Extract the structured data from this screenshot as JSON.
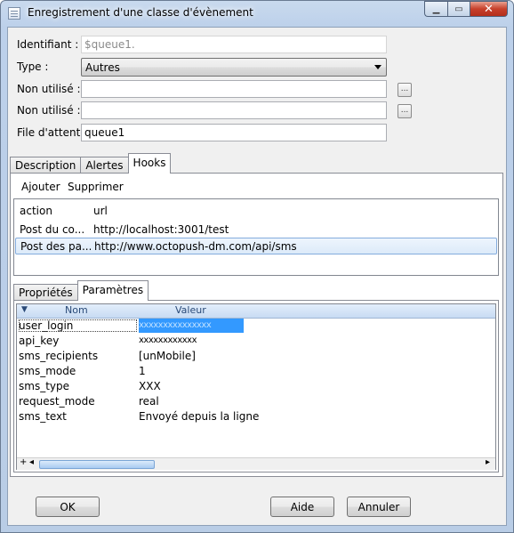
{
  "window": {
    "title": "Enregistrement d'une classe d'évènement",
    "controls": {
      "minimize": "▁",
      "maximize": "▭",
      "close": "✕"
    }
  },
  "form": {
    "identifiant": {
      "label": "Identifiant :",
      "value": "$queue1."
    },
    "type": {
      "label": "Type :",
      "value": "Autres"
    },
    "non_utilise_1": {
      "label": "Non utilisé :",
      "value": "",
      "button": "..."
    },
    "non_utilise_2": {
      "label": "Non utilisé :",
      "value": "",
      "button": "..."
    },
    "file_attente": {
      "label": "File d'attente",
      "value": "queue1"
    }
  },
  "tabs": [
    "Description",
    "Alertes",
    "Hooks"
  ],
  "active_tab": "Hooks",
  "hooks": {
    "toolbar": {
      "add": "Ajouter",
      "remove": "Supprimer"
    },
    "columns": [
      "action",
      "url"
    ],
    "rows": [
      {
        "action": "Post du co...",
        "url": "http://localhost:3001/test",
        "selected": false
      },
      {
        "action": "Post des pa...",
        "url": "http://www.octopush-dm.com/api/sms",
        "selected": true
      }
    ]
  },
  "sub_tabs": [
    "Propriétés",
    "Paramètres"
  ],
  "active_sub_tab": "Paramètres",
  "params": {
    "columns": [
      "Nom",
      "Valeur"
    ],
    "sort_indicator": "▼",
    "rows": [
      {
        "key": "user_login",
        "value": "xxxxxxxxxxxxxxx",
        "editing": true
      },
      {
        "key": "api_key",
        "value": "xxxxxxxxxxxx"
      },
      {
        "key": "sms_recipients",
        "value": "[unMobile]"
      },
      {
        "key": "sms_mode",
        "value": "1"
      },
      {
        "key": "sms_type",
        "value": "XXX"
      },
      {
        "key": "request_mode",
        "value": "real"
      },
      {
        "key": "sms_text",
        "value": "Envoyé depuis la ligne"
      }
    ],
    "scroll": {
      "plus": "+",
      "left": "◂",
      "right": "▸"
    }
  },
  "buttons": {
    "ok": "OK",
    "help": "Aide",
    "cancel": "Annuler"
  },
  "colors": {
    "selection": "#3399ff",
    "title_bg": "#bcd0ea",
    "close": "#c7402b"
  }
}
